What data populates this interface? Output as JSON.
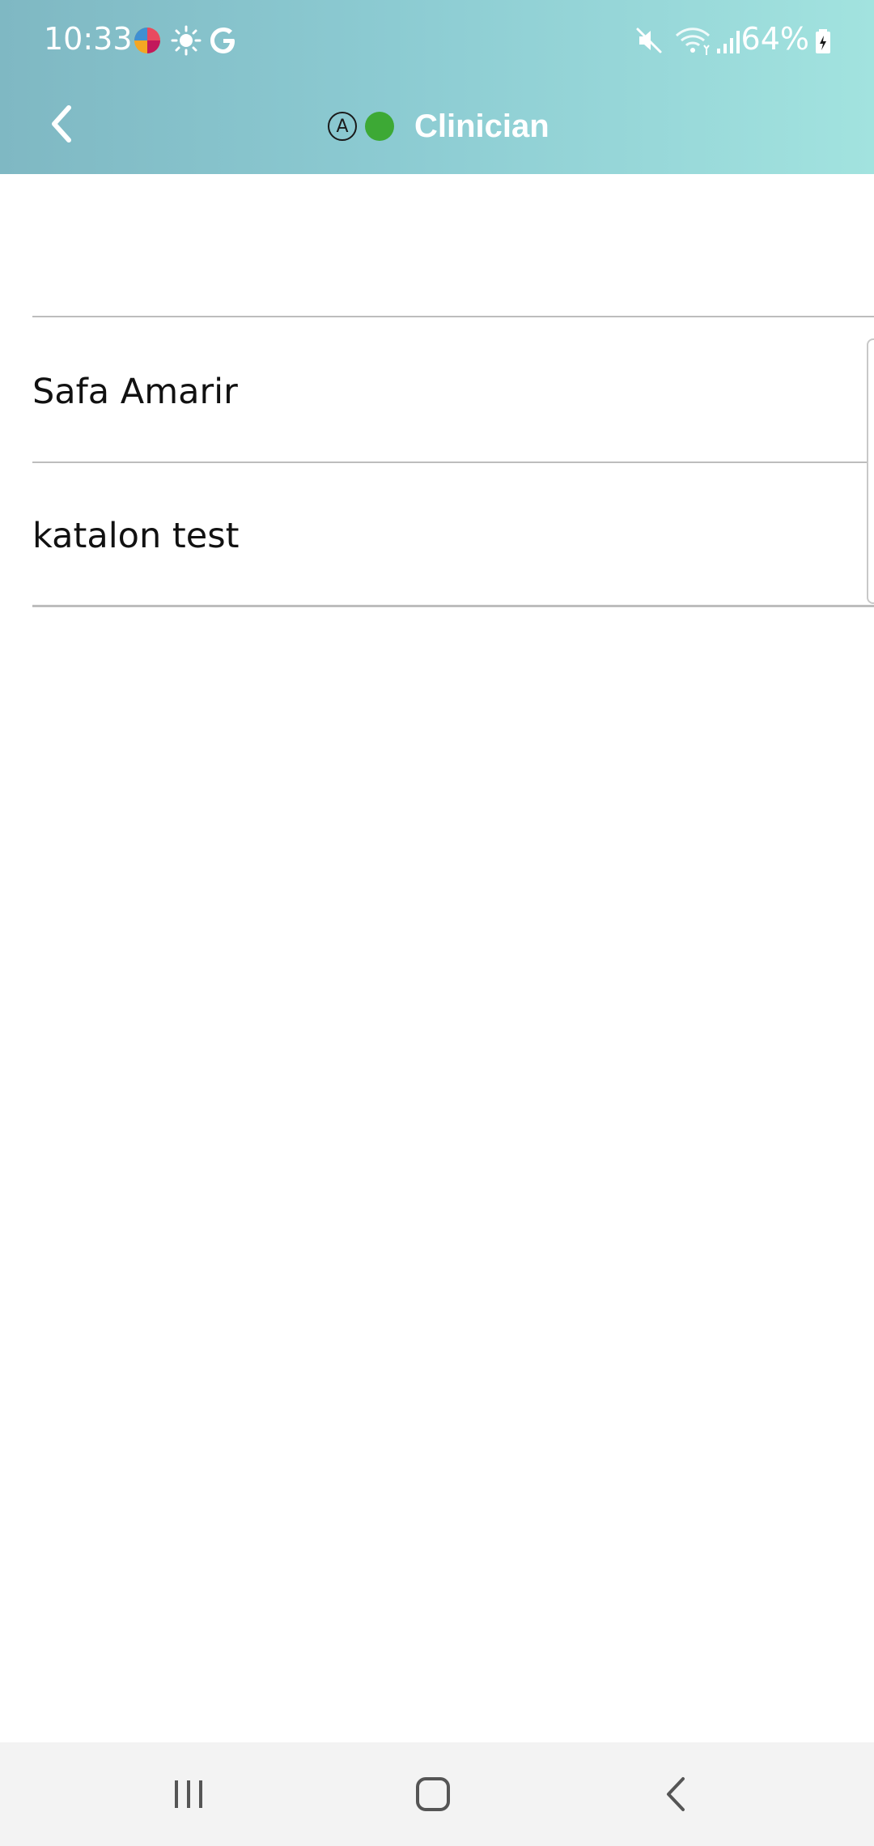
{
  "status_bar": {
    "time": "10:33",
    "battery_percent": "64%",
    "icons": [
      "multicolor-app-icon",
      "brightness-icon",
      "google-g-icon",
      "mute-icon",
      "wifi-icon",
      "signal-icon",
      "battery-icon"
    ]
  },
  "app_bar": {
    "title": "Clinician",
    "mode_letter": "A",
    "presence_color": "#3da935",
    "back_icon": "chevron-left-icon"
  },
  "list": {
    "items": [
      {
        "label": "Safa Amarir"
      },
      {
        "label": "katalon test"
      }
    ]
  },
  "nav_bar": {
    "icons": [
      "recent-apps-icon",
      "home-icon",
      "back-icon"
    ]
  },
  "colors": {
    "header_gradient_start": "#7fb8c3",
    "header_gradient_end": "#a2e3df",
    "divider": "#bdbdbd"
  }
}
